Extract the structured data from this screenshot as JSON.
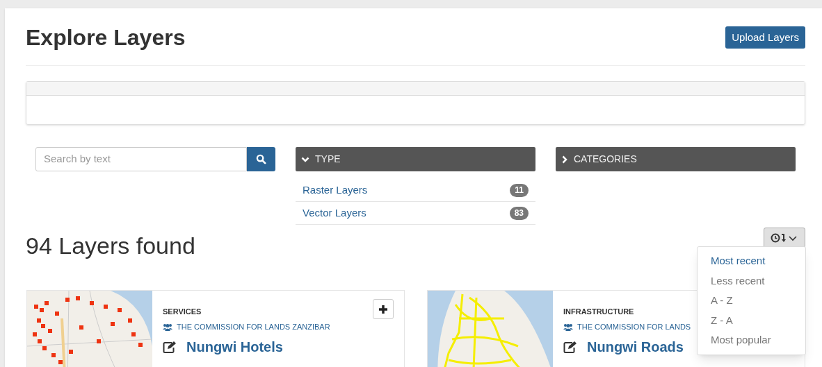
{
  "header": {
    "title": "Explore Layers",
    "upload_button": "Upload Layers"
  },
  "search": {
    "placeholder": "Search by text"
  },
  "filters": [
    {
      "label": "TYPE",
      "expanded": true,
      "items": [
        {
          "label": "Raster Layers",
          "count": "11"
        },
        {
          "label": "Vector Layers",
          "count": "83"
        }
      ]
    },
    {
      "label": "CATEGORIES",
      "expanded": false
    }
  ],
  "results": {
    "count_text": "94 Layers found"
  },
  "sort_menu": {
    "open": true,
    "options": [
      {
        "label": "Most recent",
        "selected": true
      },
      {
        "label": "Less recent",
        "selected": false
      },
      {
        "label": "A - Z",
        "selected": false
      },
      {
        "label": "Z - A",
        "selected": false
      },
      {
        "label": "Most popular",
        "selected": false
      }
    ]
  },
  "layers": [
    {
      "kind": "points",
      "category": "SERVICES",
      "owner": "THE COMMISSION FOR LANDS ZANZIBAR",
      "title": "Nungwi Hotels",
      "add_button": true
    },
    {
      "kind": "lines",
      "category": "INFRASTRUCTURE",
      "owner": "THE COMMISSION FOR LANDS",
      "title": "Nungwi Roads",
      "add_button": false
    }
  ]
}
